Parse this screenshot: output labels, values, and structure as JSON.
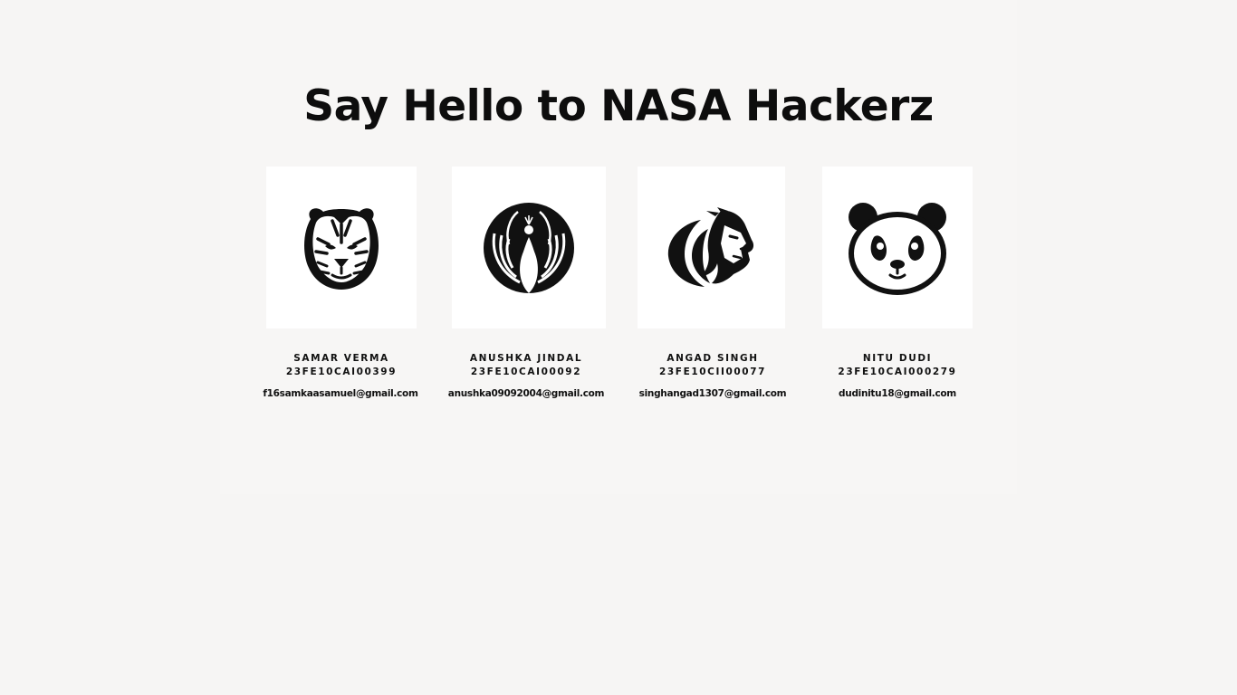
{
  "heading": "Say Hello to NASA Hackerz",
  "members": [
    {
      "name": "SAMAR VERMA",
      "roll": "23FE10CAI00399",
      "email": "f16samkaasamuel@gmail.com",
      "avatar_icon": "tiger-icon"
    },
    {
      "name": "ANUSHKA JINDAL",
      "roll": "23FE10CAI00092",
      "email": "anushka09092004@gmail.com",
      "avatar_icon": "peacock-icon"
    },
    {
      "name": "ANGAD SINGH",
      "roll": "23FE10CII00077",
      "email": "singhangad1307@gmail.com",
      "avatar_icon": "lion-icon"
    },
    {
      "name": "NITU DUDI",
      "roll": "23FE10CAI000279",
      "email": "dudinitu18@gmail.com",
      "avatar_icon": "panda-icon"
    }
  ],
  "colors": {
    "page_background": "#f6f5f4",
    "card_background": "#ffffff",
    "text": "#111111"
  }
}
